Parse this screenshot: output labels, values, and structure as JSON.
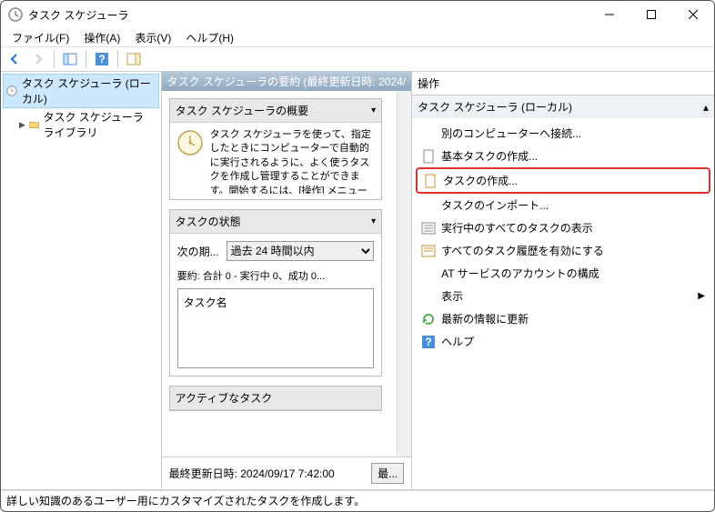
{
  "window": {
    "title": "タスク スケジューラ"
  },
  "menubar": {
    "items": [
      "ファイル(F)",
      "操作(A)",
      "表示(V)",
      "ヘルプ(H)"
    ]
  },
  "tree": {
    "root": "タスク スケジューラ (ローカル)",
    "child": "タスク スケジューラ ライブラリ"
  },
  "center": {
    "summary_header": "タスク スケジューラの要約 (最終更新日時: 2024/",
    "overview_title": "タスク スケジューラの概要",
    "overview_text": "タスク スケジューラを使って、指定したときにコンピューターで自動的に実行されるように、よく使うタスクを作成し管理することができます。開始するには、[操作] メニューのコ",
    "state_title": "タスクの状態",
    "state_period_label": "次の期...",
    "state_period_option": "過去 24 時間以内",
    "state_summary": "要約: 合計 0 - 実行中 0、成功 0...",
    "task_box_label": "タスク名",
    "active_title": "アクティブなタスク",
    "bottom_status": "最終更新日時: 2024/09/17 7:42:00",
    "refresh_btn": "最..."
  },
  "actions": {
    "pane_title": "操作",
    "group_title": "タスク スケジューラ (ローカル)",
    "items": [
      "別のコンピューターへ接続...",
      "基本タスクの作成...",
      "タスクの作成...",
      "タスクのインポート...",
      "実行中のすべてのタスクの表示",
      "すべてのタスク履歴を有効にする",
      "AT サービスのアカウントの構成",
      "表示",
      "最新の情報に更新",
      "ヘルプ"
    ]
  },
  "statusbar": {
    "text": "詳しい知識のあるユーザー用にカスタマイズされたタスクを作成します。"
  }
}
